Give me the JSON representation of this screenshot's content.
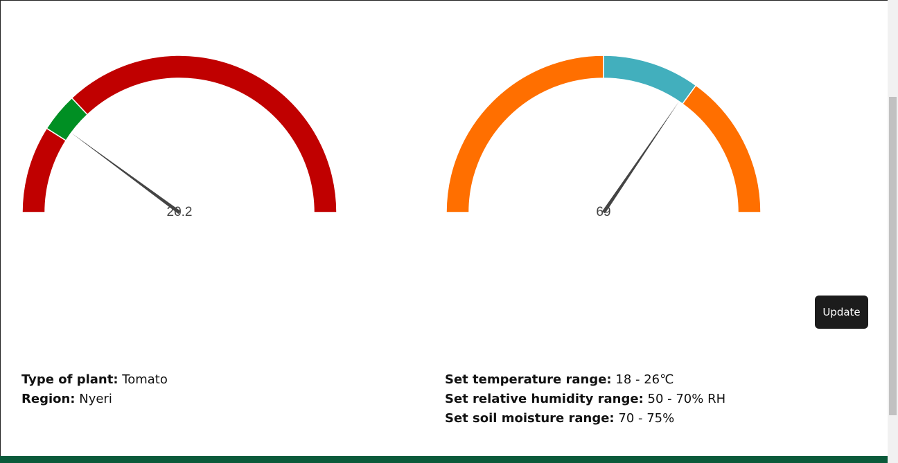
{
  "gauges": [
    {
      "id": "temperature",
      "value": 20.2,
      "value_label": "20.2",
      "min": 0,
      "max": 100,
      "range": [
        18,
        26
      ],
      "in_range_color": "#008f23",
      "out_range_color": "#c00000"
    },
    {
      "id": "humidity",
      "value": 69,
      "value_label": "69",
      "min": 0,
      "max": 100,
      "range": [
        50,
        70
      ],
      "in_range_color": "#42afbd",
      "out_range_color": "#ff6f00"
    }
  ],
  "needle_color": "#444444",
  "update_button": {
    "label": "Update"
  },
  "plant_info": {
    "type_label": "Type of plant:",
    "type_value": " Tomato",
    "region_label": "Region:",
    "region_value": " Nyeri"
  },
  "settings": {
    "temperature_label": "Set temperature range:",
    "temperature_value": " 18 - 26℃",
    "humidity_label": "Set relative humidity range:",
    "humidity_value": " 50 - 70% RH",
    "soil_label": "Set soil moisture range:",
    "soil_value": " 70 - 75%"
  },
  "footer_color": "#0b5a3a"
}
